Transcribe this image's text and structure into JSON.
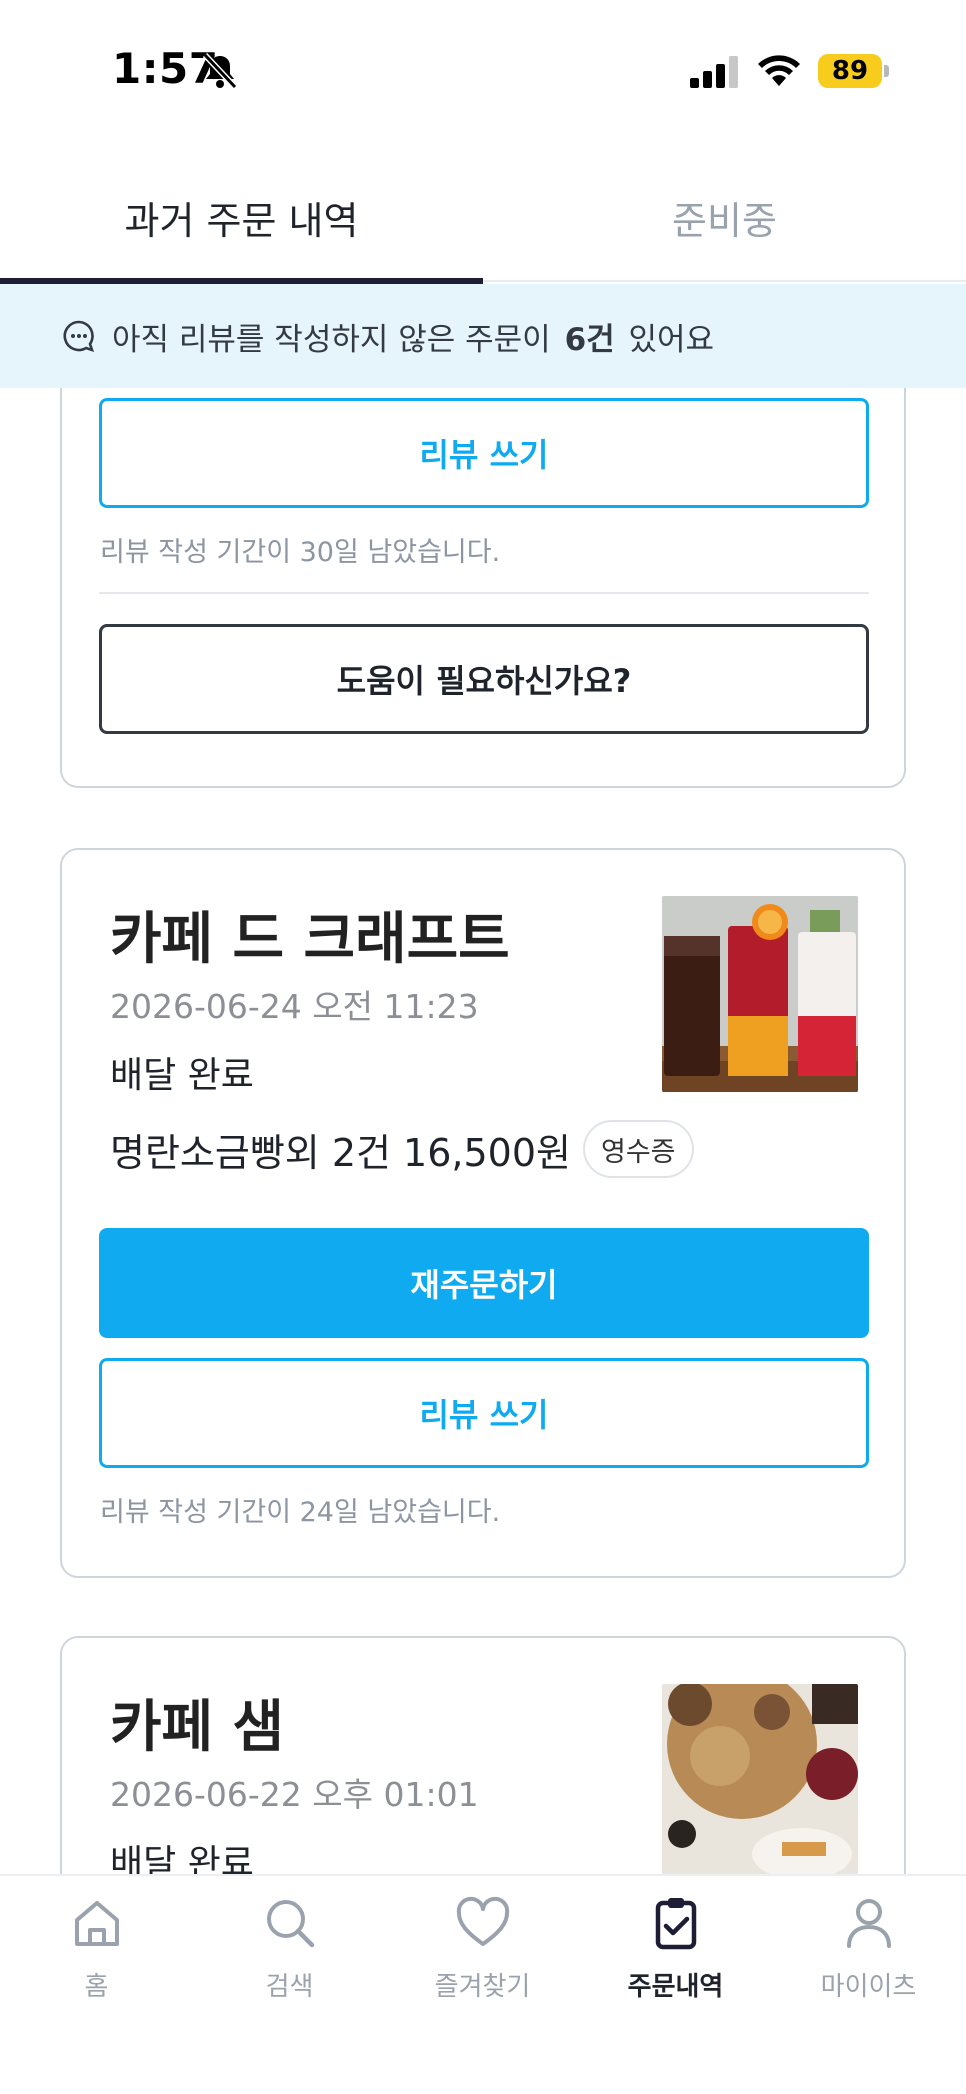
{
  "status_bar": {
    "time": "1:57",
    "battery": "89"
  },
  "tabs": [
    {
      "label": "과거 주문 내역",
      "active": true
    },
    {
      "label": "준비중",
      "active": false
    }
  ],
  "banner": {
    "prefix": "아직 리뷰를 작성하지 않은 주문이",
    "count": "6건",
    "suffix": "있어요"
  },
  "orders": [
    {
      "review_label": "리뷰 쓰기",
      "review_note": "리뷰 작성 기간이 30일 남았습니다.",
      "help_label": "도움이 필요하신가요?"
    },
    {
      "store": "카페 드 크래프트",
      "date": "2026-06-24 오전 11:23",
      "status": "배달 완료",
      "summary": "명란소금빵외 2건 16,500원",
      "receipt_label": "영수증",
      "reorder_label": "재주문하기",
      "review_label": "리뷰 쓰기",
      "review_note": "리뷰 작성 기간이 24일 남았습니다."
    },
    {
      "store": "카페 샘",
      "date": "2026-06-22 오후 01:01",
      "status": "배달 완료"
    }
  ],
  "bottom_nav": [
    {
      "label": "홈",
      "icon": "home-icon",
      "active": false
    },
    {
      "label": "검색",
      "icon": "search-icon",
      "active": false
    },
    {
      "label": "즐겨찾기",
      "icon": "heart-icon",
      "active": false
    },
    {
      "label": "주문내역",
      "icon": "clipboard-check-icon",
      "active": true
    },
    {
      "label": "마이이츠",
      "icon": "person-icon",
      "active": false
    }
  ],
  "colors": {
    "accent": "#10aaf0",
    "banner_bg": "#e6f4fb",
    "tab_indicator": "#1d1d35",
    "battery": "#f7cc1d"
  }
}
